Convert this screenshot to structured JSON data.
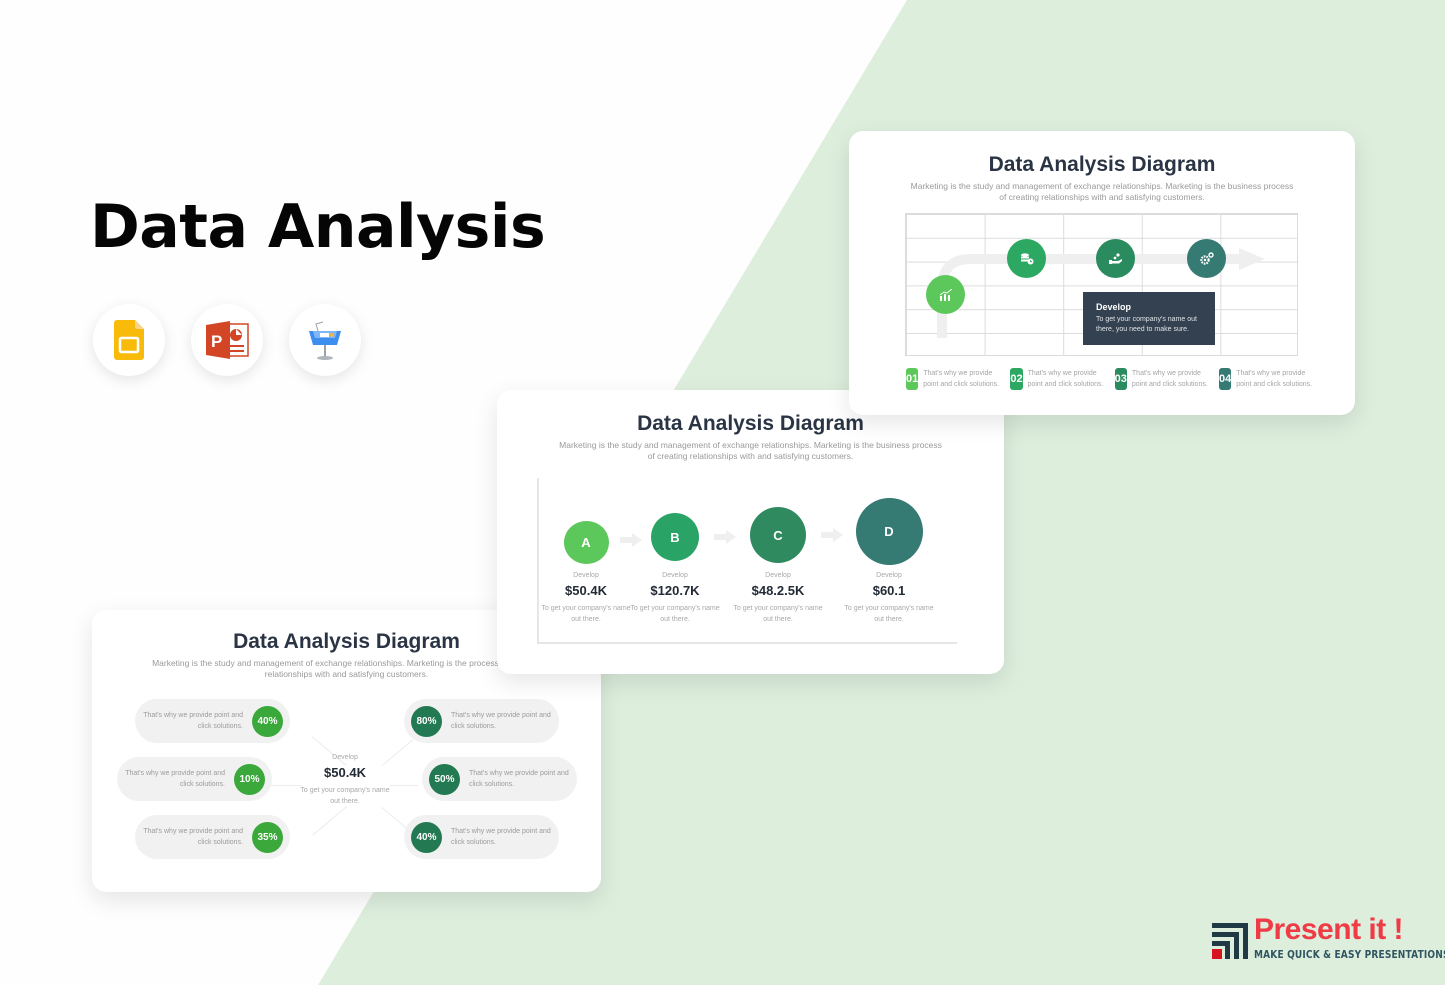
{
  "hero": {
    "title": "Data Analysis",
    "apps": [
      {
        "name": "Google Slides",
        "icon": "google-slides-icon"
      },
      {
        "name": "PowerPoint",
        "icon": "powerpoint-icon"
      },
      {
        "name": "Keynote",
        "icon": "keynote-icon"
      }
    ]
  },
  "slides": {
    "subtitle": "Marketing is the study and management of exchange relationships. Marketing is the business process of creating relationships with and satisfying customers.",
    "roadmap": {
      "title": "Data Analysis Diagram",
      "icons": [
        "chart-growth-icon",
        "database-clock-icon",
        "hand-coin-icon",
        "gears-icon"
      ],
      "tooltip": {
        "title": "Develop",
        "body": "To get your company's name out there, you need to make sure."
      },
      "steps": [
        {
          "num": "01",
          "text": "That's why we provide point and click solutions.",
          "color": "#5cc75a"
        },
        {
          "num": "02",
          "text": "That's why we provide point and click solutions.",
          "color": "#2da862"
        },
        {
          "num": "03",
          "text": "That's why we provide point and click solutions.",
          "color": "#2a8b5f"
        },
        {
          "num": "04",
          "text": "That's why we provide point and click solutions.",
          "color": "#357a73"
        }
      ]
    },
    "growth": {
      "title": "Data Analysis Diagram",
      "nodes": [
        {
          "letter": "A",
          "label": "Develop",
          "value": "$50.4K",
          "desc": "To get your company's name out there.",
          "color": "#5cc75a"
        },
        {
          "letter": "B",
          "label": "Develop",
          "value": "$120.7K",
          "desc": "To get your company's name out there.",
          "color": "#2aa466"
        },
        {
          "letter": "C",
          "label": "Develop",
          "value": "$48.2.5K",
          "desc": "To get your company's name out there.",
          "color": "#2f8a60"
        },
        {
          "letter": "D",
          "label": "Develop",
          "value": "$60.1",
          "desc": "To get your company's name out there.",
          "color": "#357a73"
        }
      ]
    },
    "hub": {
      "title": "Data Analysis Diagram",
      "subtitle_visible": "Marketing is the study and management of exchange relationships. Marketing is the process of creating relationships with and satisfying customers.",
      "center": {
        "label": "Develop",
        "value": "$50.4K",
        "desc": "To get your company's name out there."
      },
      "left": [
        {
          "pct": "40%",
          "text": "That's why we provide point and click solutions."
        },
        {
          "pct": "10%",
          "text": "That's why we provide point and click solutions."
        },
        {
          "pct": "35%",
          "text": "That's why we provide point and click solutions."
        }
      ],
      "right": [
        {
          "pct": "80%",
          "text": "That's why we provide point and click solutions."
        },
        {
          "pct": "50%",
          "text": "That's why we provide point and click solutions."
        },
        {
          "pct": "40%",
          "text": "That's why we provide point and click solutions."
        }
      ],
      "left_color": "#3aa83a",
      "right_color": "#237a52"
    }
  },
  "brand": {
    "name": "Present it !",
    "tagline": "MAKE QUICK & EASY PRESENTATIONS"
  }
}
